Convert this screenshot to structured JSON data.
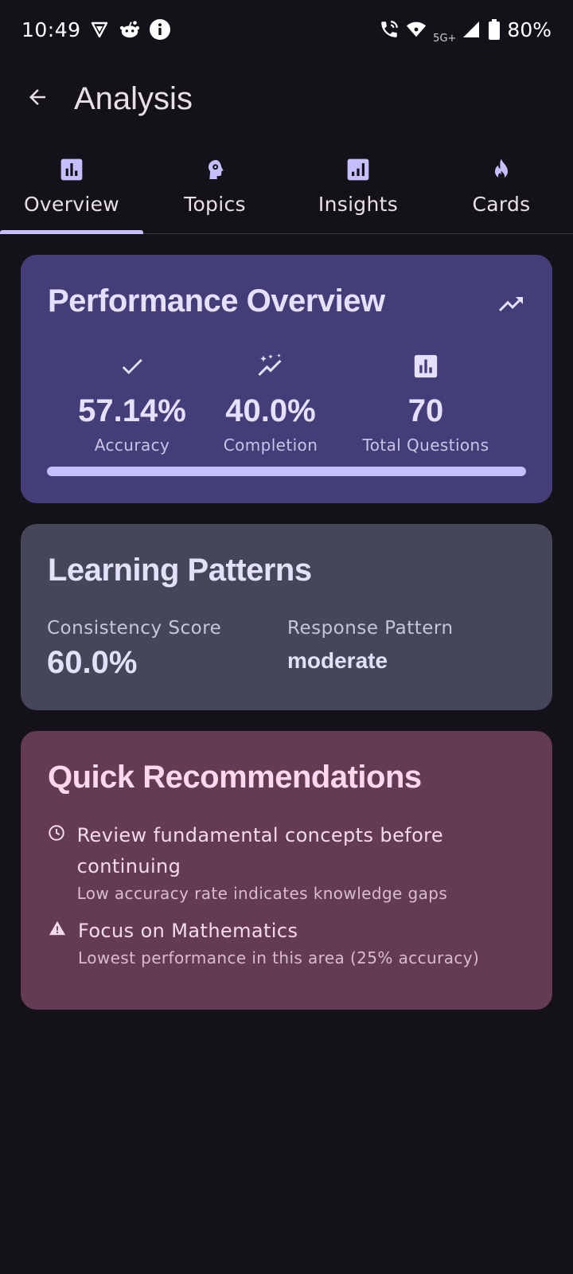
{
  "status_bar": {
    "time": "10:49",
    "network_label": "5G+",
    "battery": "80%",
    "left_icons": [
      "vpn-shield-icon",
      "reddit-icon",
      "info-icon"
    ],
    "right_icons": [
      "wifi-calling-icon",
      "wifi-icon",
      "signal-icon",
      "battery-icon"
    ]
  },
  "app_bar": {
    "title": "Analysis",
    "back_icon": "arrow-back-icon"
  },
  "tabs": [
    {
      "label": "Overview",
      "icon": "bar-chart-icon",
      "active": true
    },
    {
      "label": "Topics",
      "icon": "psychology-head-icon",
      "active": false
    },
    {
      "label": "Insights",
      "icon": "insights-chart-icon",
      "active": false
    },
    {
      "label": "Cards",
      "icon": "fire-icon",
      "active": false
    }
  ],
  "performance": {
    "title": "Performance Overview",
    "trend_icon": "trending-up-icon",
    "stats": [
      {
        "icon": "check-icon",
        "value": "57.14%",
        "label": "Accuracy"
      },
      {
        "icon": "sparkle-trend-icon",
        "value": "40.0%",
        "label": "Completion"
      },
      {
        "icon": "bar-chart-icon",
        "value": "70",
        "label": "Total Questions"
      }
    ],
    "progress_fraction": 1.0
  },
  "patterns": {
    "title": "Learning Patterns",
    "consistency_label": "Consistency Score",
    "consistency_value": "60.0%",
    "response_label": "Response Pattern",
    "response_value": "moderate"
  },
  "recommendations": {
    "title": "Quick Recommendations",
    "items": [
      {
        "icon": "clock-icon",
        "title": "Review fundamental concepts before continuing",
        "subtitle": "Low accuracy rate indicates knowledge gaps"
      },
      {
        "icon": "warning-icon",
        "title": "Focus on Mathematics",
        "subtitle": "Lowest performance in this area (25% accuracy)"
      }
    ]
  },
  "colors": {
    "background": "#141218",
    "accent": "#c6bfff",
    "performance_card": "#433e78",
    "patterns_card": "#45465a",
    "recommendations_card": "#633b55"
  }
}
